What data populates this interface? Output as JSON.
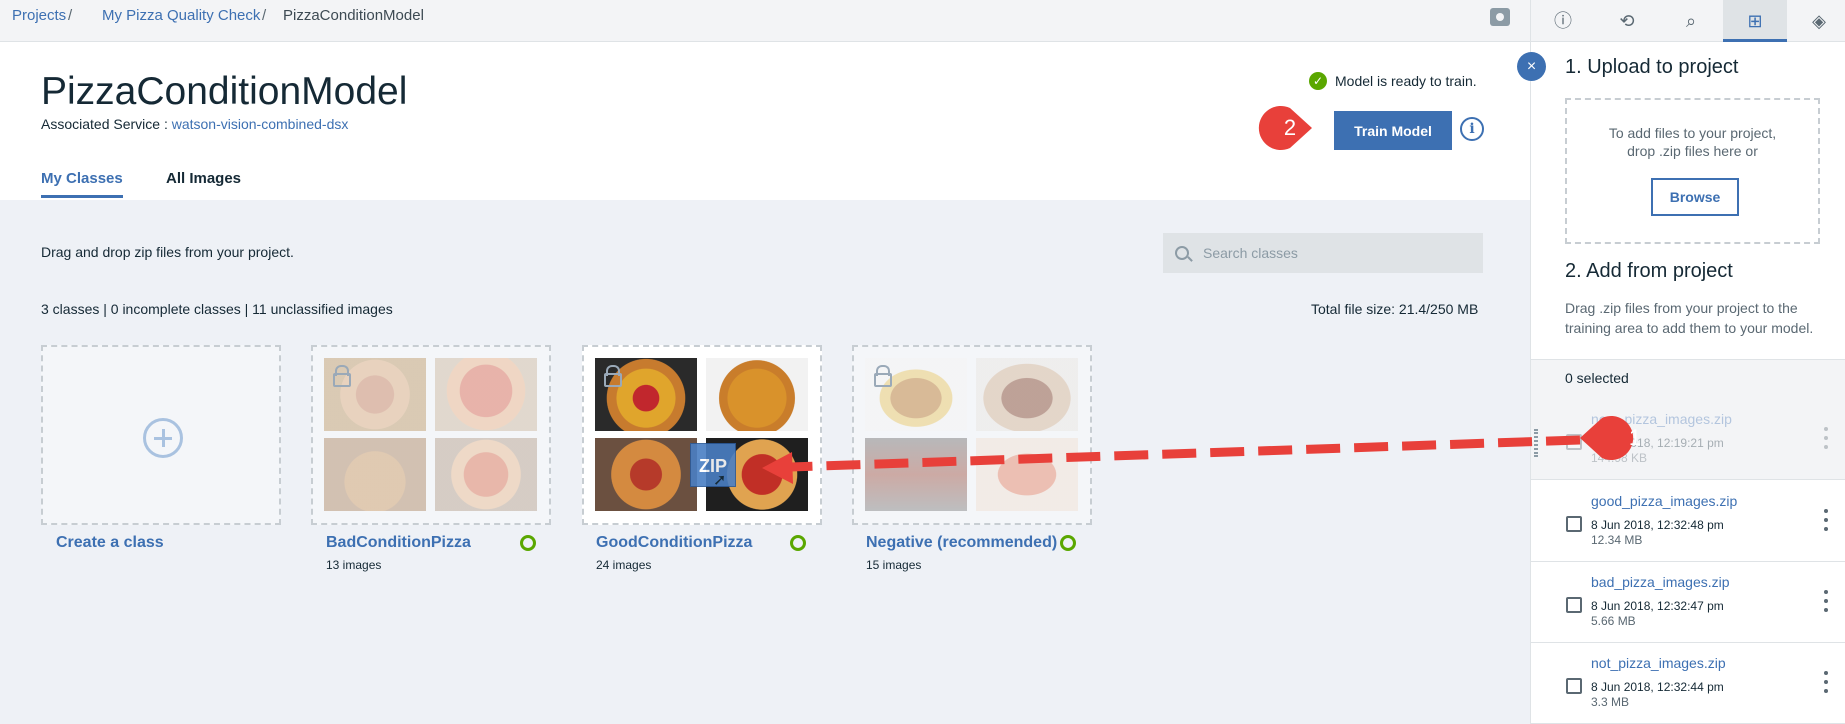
{
  "breadcrumb": {
    "items": [
      "Projects",
      "My Pizza Quality Check",
      "PizzaConditionModel"
    ],
    "separator": "/"
  },
  "header": {
    "title": "PizzaConditionModel",
    "assoc_label": "Associated Service : ",
    "assoc_service": "watson-vision-combined-dsx",
    "ready_text": "Model is ready to train.",
    "train_button": "Train Model",
    "info_glyph": "i"
  },
  "tabs": [
    {
      "label": "My Classes",
      "active": true
    },
    {
      "label": "All Images",
      "active": false
    }
  ],
  "content": {
    "drag_note": "Drag and drop zip files from your project.",
    "search_placeholder": "Search classes",
    "stats": "3 classes | 0 incomplete classes | 11 unclassified images",
    "file_size": "Total file size: 21.4/250 MB"
  },
  "classes": [
    {
      "name": "Create a class",
      "count": ""
    },
    {
      "name": "BadConditionPizza",
      "count": "13 images"
    },
    {
      "name": "GoodConditionPizza",
      "count": "24 images"
    },
    {
      "name": "Negative (recommended)",
      "count": "15 images"
    }
  ],
  "zip_label": "ZIP",
  "panel": {
    "upload_title": "1. Upload to project",
    "drop_text": "To add files to your project,\ndrop .zip files here or",
    "browse_button": "Browse",
    "add_title": "2. Add from project",
    "add_desc": "Drag .zip files from your project to the training area to add them to your model.",
    "selected": "0 selected",
    "files": [
      {
        "name": "new_pizza_images.zip",
        "date": "8 Jun 2018, 12:19:21 pm",
        "size": "144.98 KB"
      },
      {
        "name": "good_pizza_images.zip",
        "date": "8 Jun 2018, 12:32:48 pm",
        "size": "12.34 MB"
      },
      {
        "name": "bad_pizza_images.zip",
        "date": "8 Jun 2018, 12:32:47 pm",
        "size": "5.66 MB"
      },
      {
        "name": "not_pizza_images.zip",
        "date": "8 Jun 2018, 12:32:44 pm",
        "size": "3.3 MB"
      }
    ]
  },
  "annotations": {
    "step1": "1",
    "step2": "2"
  },
  "icons": {
    "toolbar": [
      "info-icon",
      "history-icon",
      "find-replace-icon",
      "data-icon",
      "compass-icon"
    ],
    "close": "×"
  },
  "colors": {
    "accent": "#3d70b2",
    "success": "#5aa700",
    "annotation": "#e8403a"
  }
}
